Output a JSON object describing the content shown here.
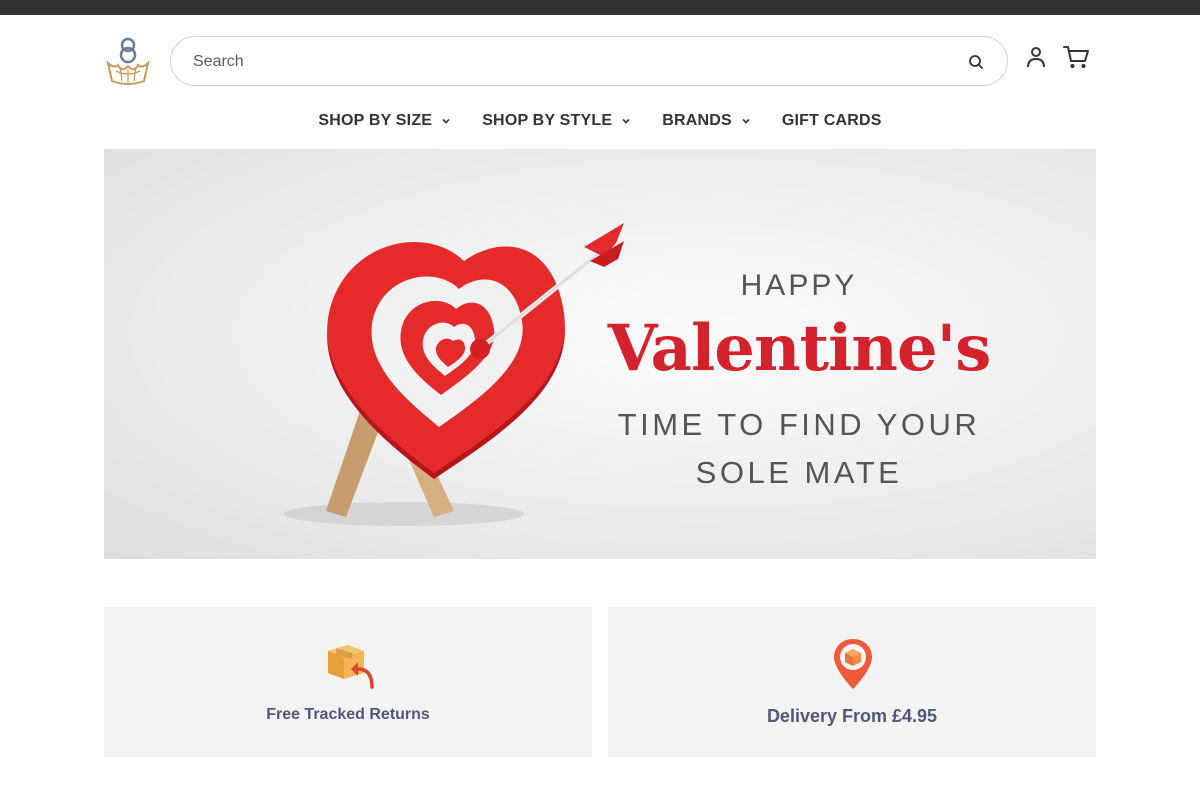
{
  "header": {
    "search": {
      "placeholder": "Search",
      "value": ""
    },
    "icons": {
      "logo": "crown-logo",
      "search": "search-icon",
      "account": "account-icon",
      "cart": "cart-icon"
    }
  },
  "nav": {
    "items": [
      {
        "label": "SHOP BY SIZE",
        "has_dropdown": true
      },
      {
        "label": "SHOP BY STYLE",
        "has_dropdown": true
      },
      {
        "label": "BRANDS",
        "has_dropdown": true
      },
      {
        "label": "GIFT CARDS",
        "has_dropdown": false
      }
    ]
  },
  "hero": {
    "line_top": "HAPPY",
    "headline": "Valentine's",
    "line_1": "TIME TO FIND YOUR",
    "line_2": "SOLE MATE",
    "headline_color": "#d4222c"
  },
  "features": [
    {
      "label": "Free Tracked Returns",
      "icon": "returns-box-icon"
    },
    {
      "label": "Delivery From £4.95",
      "icon": "delivery-pin-icon"
    }
  ],
  "colors": {
    "topbar": "#333333",
    "feature_bg": "#f3f3f3",
    "feature_text": "#50587a"
  }
}
